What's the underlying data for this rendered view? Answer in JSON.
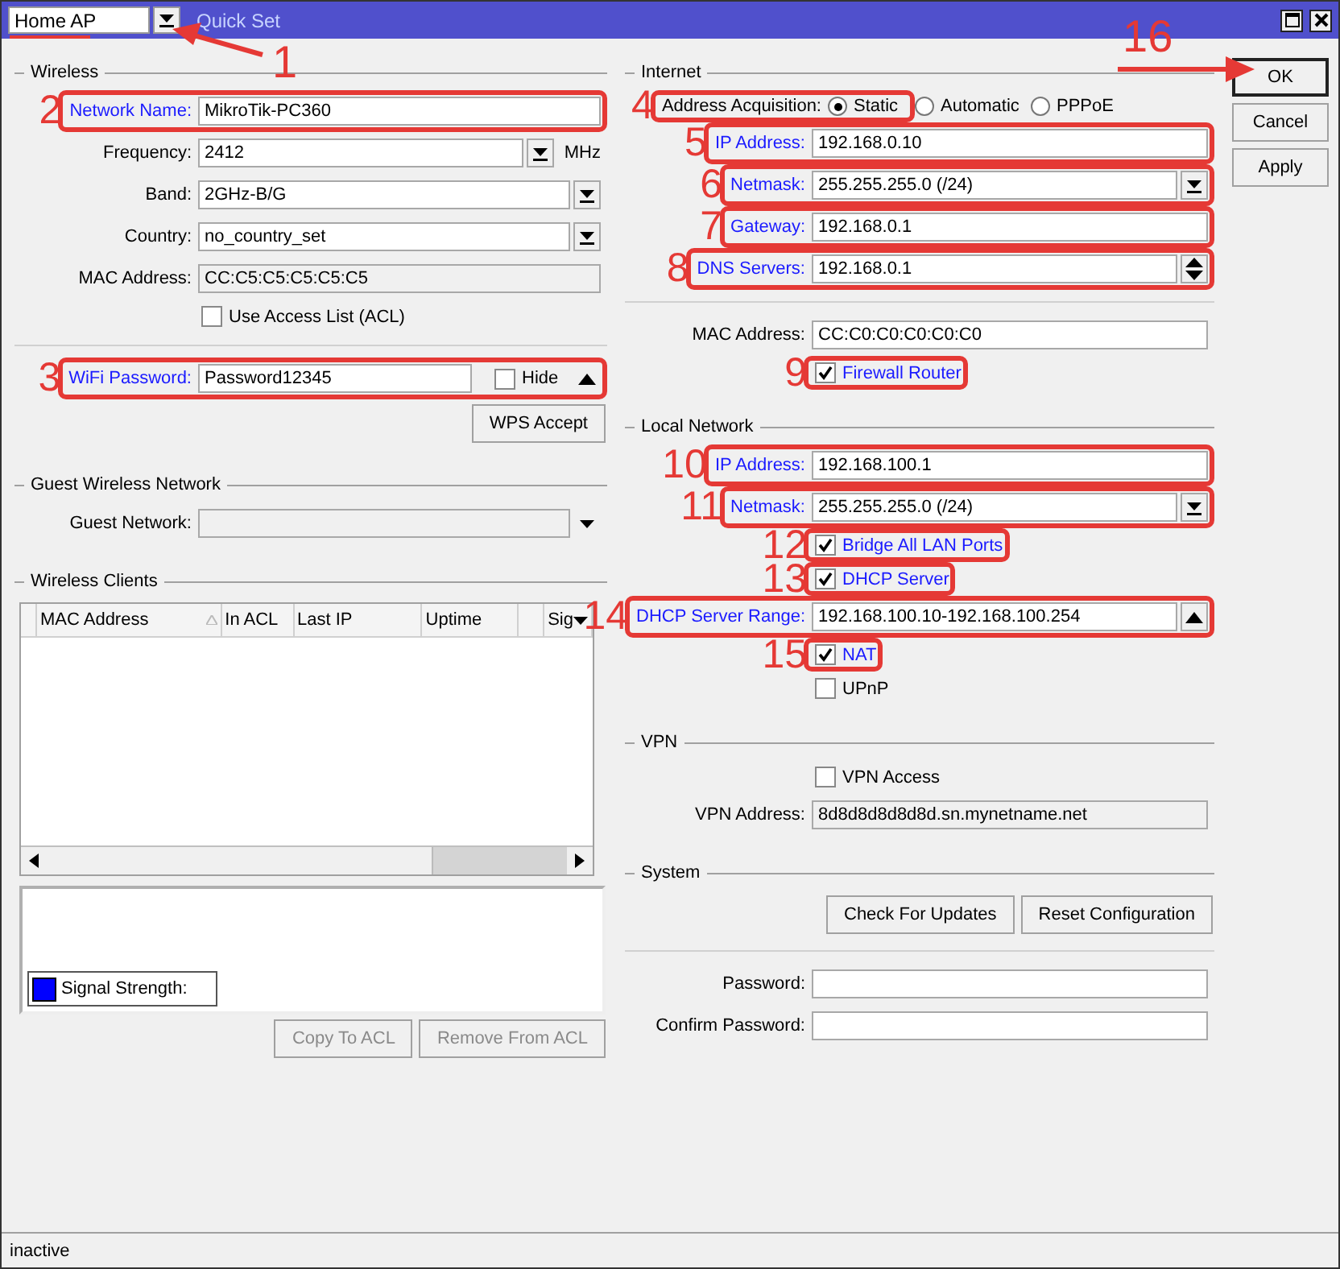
{
  "title_bar": {
    "mode": "Home AP",
    "mode_callout": "1",
    "title": "Quick Set"
  },
  "left": [
    {
      "kind": "header",
      "label": "Wireless"
    },
    {
      "kind": "field",
      "label": "Network Name:",
      "value": "MikroTik-PC360",
      "link": true,
      "highlight": true,
      "callout": "2",
      "disabled": false
    },
    {
      "kind": "field",
      "label": "Frequency:",
      "value": "2412",
      "arrow": {
        "kind": "dropdown"
      },
      "suffix": "MHz",
      "disabled": false
    },
    {
      "kind": "field",
      "label": "Band:",
      "value": "2GHz-B/G",
      "arrow": {
        "kind": "dropdown"
      },
      "disabled": false
    },
    {
      "kind": "field",
      "label": "Country:",
      "value": "no_country_set",
      "arrow": {
        "kind": "dropdown"
      },
      "disabled": false
    },
    {
      "kind": "field",
      "label": "MAC Address:",
      "value": "CC:C5:C5:C5:C5:C5",
      "disabled": true
    },
    {
      "kind": "checkbox",
      "label": "Use Access List (ACL)",
      "checked": false
    },
    {
      "kind": "divider"
    },
    {
      "kind": "password",
      "label": "WiFi Password:",
      "value": "Password12345",
      "link": true,
      "highlight": true,
      "callout": "3",
      "hide_label": "Hide",
      "hide_checked": false,
      "arrow": {
        "kind": "up"
      }
    },
    {
      "kind": "buttons",
      "buttons": [
        {
          "label": "WPS Accept",
          "disabled": false
        }
      ]
    },
    {
      "kind": "header",
      "label": "Guest Wireless Network"
    },
    {
      "kind": "field",
      "label": "Guest Network:",
      "arrow": {
        "kind": "down"
      },
      "disabled": true
    },
    {
      "kind": "header",
      "label": "Wireless Clients"
    },
    {
      "kind": "table",
      "columns": [
        {
          "label": "MAC Address",
          "sorted": true
        },
        {
          "label": "In ACL",
          "sorted": false
        },
        {
          "label": "Last IP",
          "sorted": false
        },
        {
          "label": "Uptime",
          "sorted": false
        },
        {
          "label": "Sig",
          "sorted": false
        }
      ]
    },
    {
      "kind": "graph",
      "legend": "Signal Strength:",
      "color": "#0000ff"
    },
    {
      "kind": "buttons",
      "buttons": [
        {
          "label": "Copy To ACL",
          "disabled": true
        },
        {
          "label": "Remove From ACL",
          "disabled": true
        }
      ]
    }
  ],
  "right": [
    {
      "kind": "header",
      "label": "Internet"
    },
    {
      "kind": "radio",
      "label": "Address Acquisition:",
      "highlight": true,
      "callout": "4",
      "options": [
        {
          "label": "Static",
          "selected": true
        },
        {
          "label": "Automatic",
          "selected": false
        },
        {
          "label": "PPPoE",
          "selected": false
        }
      ]
    },
    {
      "kind": "field",
      "label": "IP Address:",
      "value": "192.168.0.10",
      "link": true,
      "highlight": true,
      "callout": "5",
      "disabled": false
    },
    {
      "kind": "field",
      "label": "Netmask:",
      "value": "255.255.255.0 (/24)",
      "arrow": {
        "kind": "dropdown"
      },
      "link": true,
      "highlight": true,
      "callout": "6",
      "disabled": false
    },
    {
      "kind": "field",
      "label": "Gateway:",
      "value": "192.168.0.1",
      "link": true,
      "highlight": true,
      "callout": "7",
      "disabled": false
    },
    {
      "kind": "field",
      "label": "DNS Servers:",
      "value": "192.168.0.1",
      "arrow": {
        "kind": "updown"
      },
      "link": true,
      "highlight": true,
      "callout": "8",
      "disabled": false
    },
    {
      "kind": "divider"
    },
    {
      "kind": "field",
      "label": "MAC Address:",
      "value": "CC:C0:C0:C0:C0:C0",
      "disabled": false
    },
    {
      "kind": "checkbox",
      "label": "Firewall Router",
      "checked": true,
      "link": true,
      "highlight": true,
      "callout": "9"
    },
    {
      "kind": "header",
      "label": "Local Network"
    },
    {
      "kind": "field",
      "label": "IP Address:",
      "value": "192.168.100.1",
      "link": true,
      "highlight": true,
      "callout": "10",
      "disabled": false
    },
    {
      "kind": "field",
      "label": "Netmask:",
      "value": "255.255.255.0 (/24)",
      "arrow": {
        "kind": "dropdown"
      },
      "link": true,
      "highlight": true,
      "callout": "11",
      "disabled": false
    },
    {
      "kind": "checkbox",
      "label": "Bridge All LAN Ports",
      "checked": true,
      "link": true,
      "highlight": true,
      "callout": "12"
    },
    {
      "kind": "checkbox",
      "label": "DHCP Server",
      "checked": true,
      "link": true,
      "highlight": true,
      "callout": "13"
    },
    {
      "kind": "field",
      "label": "DHCP Server Range:",
      "value": "192.168.100.10-192.168.100.254",
      "arrow": {
        "kind": "boxed_up"
      },
      "link": true,
      "highlight": true,
      "callout": "14",
      "disabled": false
    },
    {
      "kind": "checkbox",
      "label": "NAT",
      "checked": true,
      "link": true,
      "highlight": true,
      "callout": "15"
    },
    {
      "kind": "checkbox",
      "label": "UPnP",
      "checked": false
    },
    {
      "kind": "header",
      "label": "VPN"
    },
    {
      "kind": "checkbox",
      "label": "VPN Access",
      "checked": false
    },
    {
      "kind": "field",
      "label": "VPN Address:",
      "value": "8d8d8d8d8d8d.sn.mynetname.net",
      "disabled": true
    },
    {
      "kind": "header",
      "label": "System"
    },
    {
      "kind": "buttons",
      "buttons": [
        {
          "label": "Check For Updates",
          "disabled": false
        },
        {
          "label": "Reset Configuration",
          "disabled": false
        }
      ]
    },
    {
      "kind": "divider"
    },
    {
      "kind": "field",
      "label": "Password:",
      "disabled": false
    },
    {
      "kind": "field",
      "label": "Confirm Password:",
      "disabled": false
    }
  ],
  "side_buttons": [
    {
      "label": "OK",
      "default": true,
      "callout": "16"
    },
    {
      "label": "Cancel",
      "default": false
    },
    {
      "label": "Apply",
      "default": false
    }
  ],
  "status_bar": "inactive"
}
